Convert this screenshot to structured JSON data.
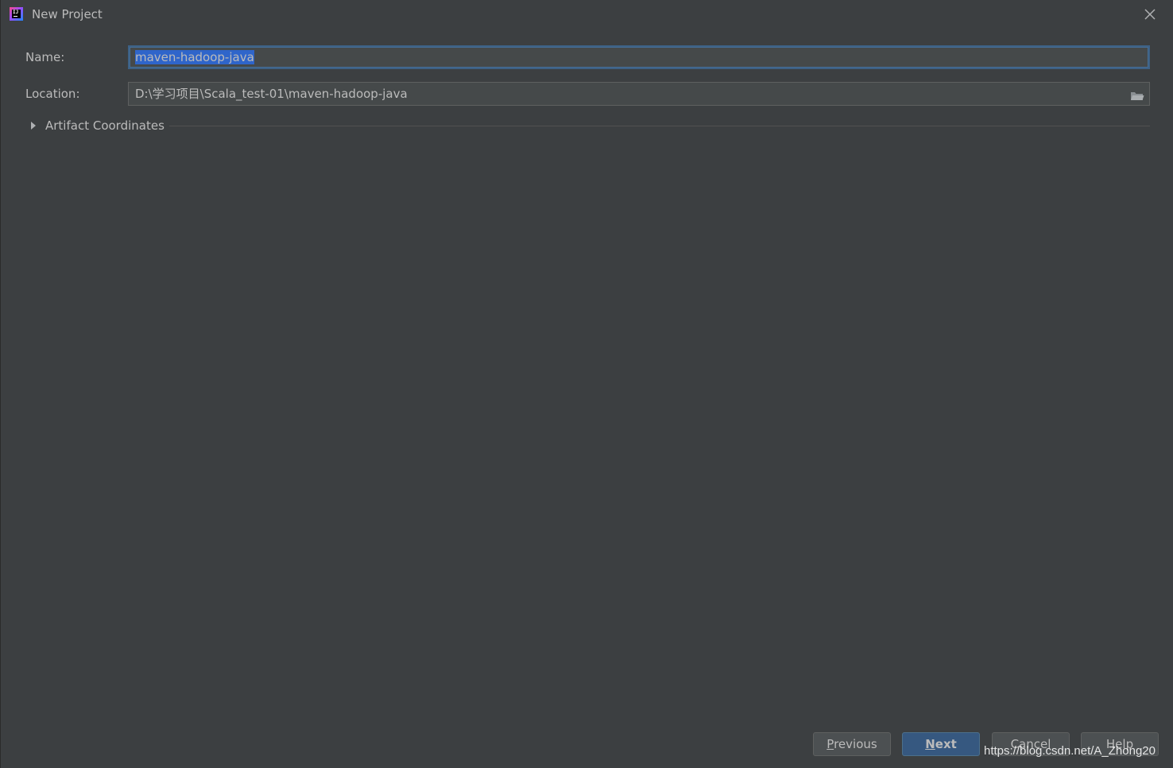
{
  "window": {
    "title": "New Project",
    "app_icon": "intellij-idea-icon",
    "close_icon": "close-icon"
  },
  "form": {
    "name_label": "Name:",
    "name_value": "maven-hadoop-java",
    "location_label": "Location:",
    "location_value": "D:\\学习项目\\Scala_test-01\\maven-hadoop-java",
    "browse_icon": "folder-icon"
  },
  "section": {
    "label": "Artifact Coordinates",
    "expanded": false,
    "icon": "expand-triangle-icon"
  },
  "buttons": {
    "previous_first": "P",
    "previous_rest": "revious",
    "next_first": "N",
    "next_rest": "ext",
    "cancel": "Cancel",
    "help": "Help"
  },
  "watermark": "https://blog.csdn.net/A_Zhong20",
  "colors": {
    "background": "#3c3f41",
    "field_background": "#45494a",
    "focus_border": "#3d6185",
    "selection": "#2f65ca",
    "default_button": "#365880",
    "text": "#bbbbbb"
  }
}
